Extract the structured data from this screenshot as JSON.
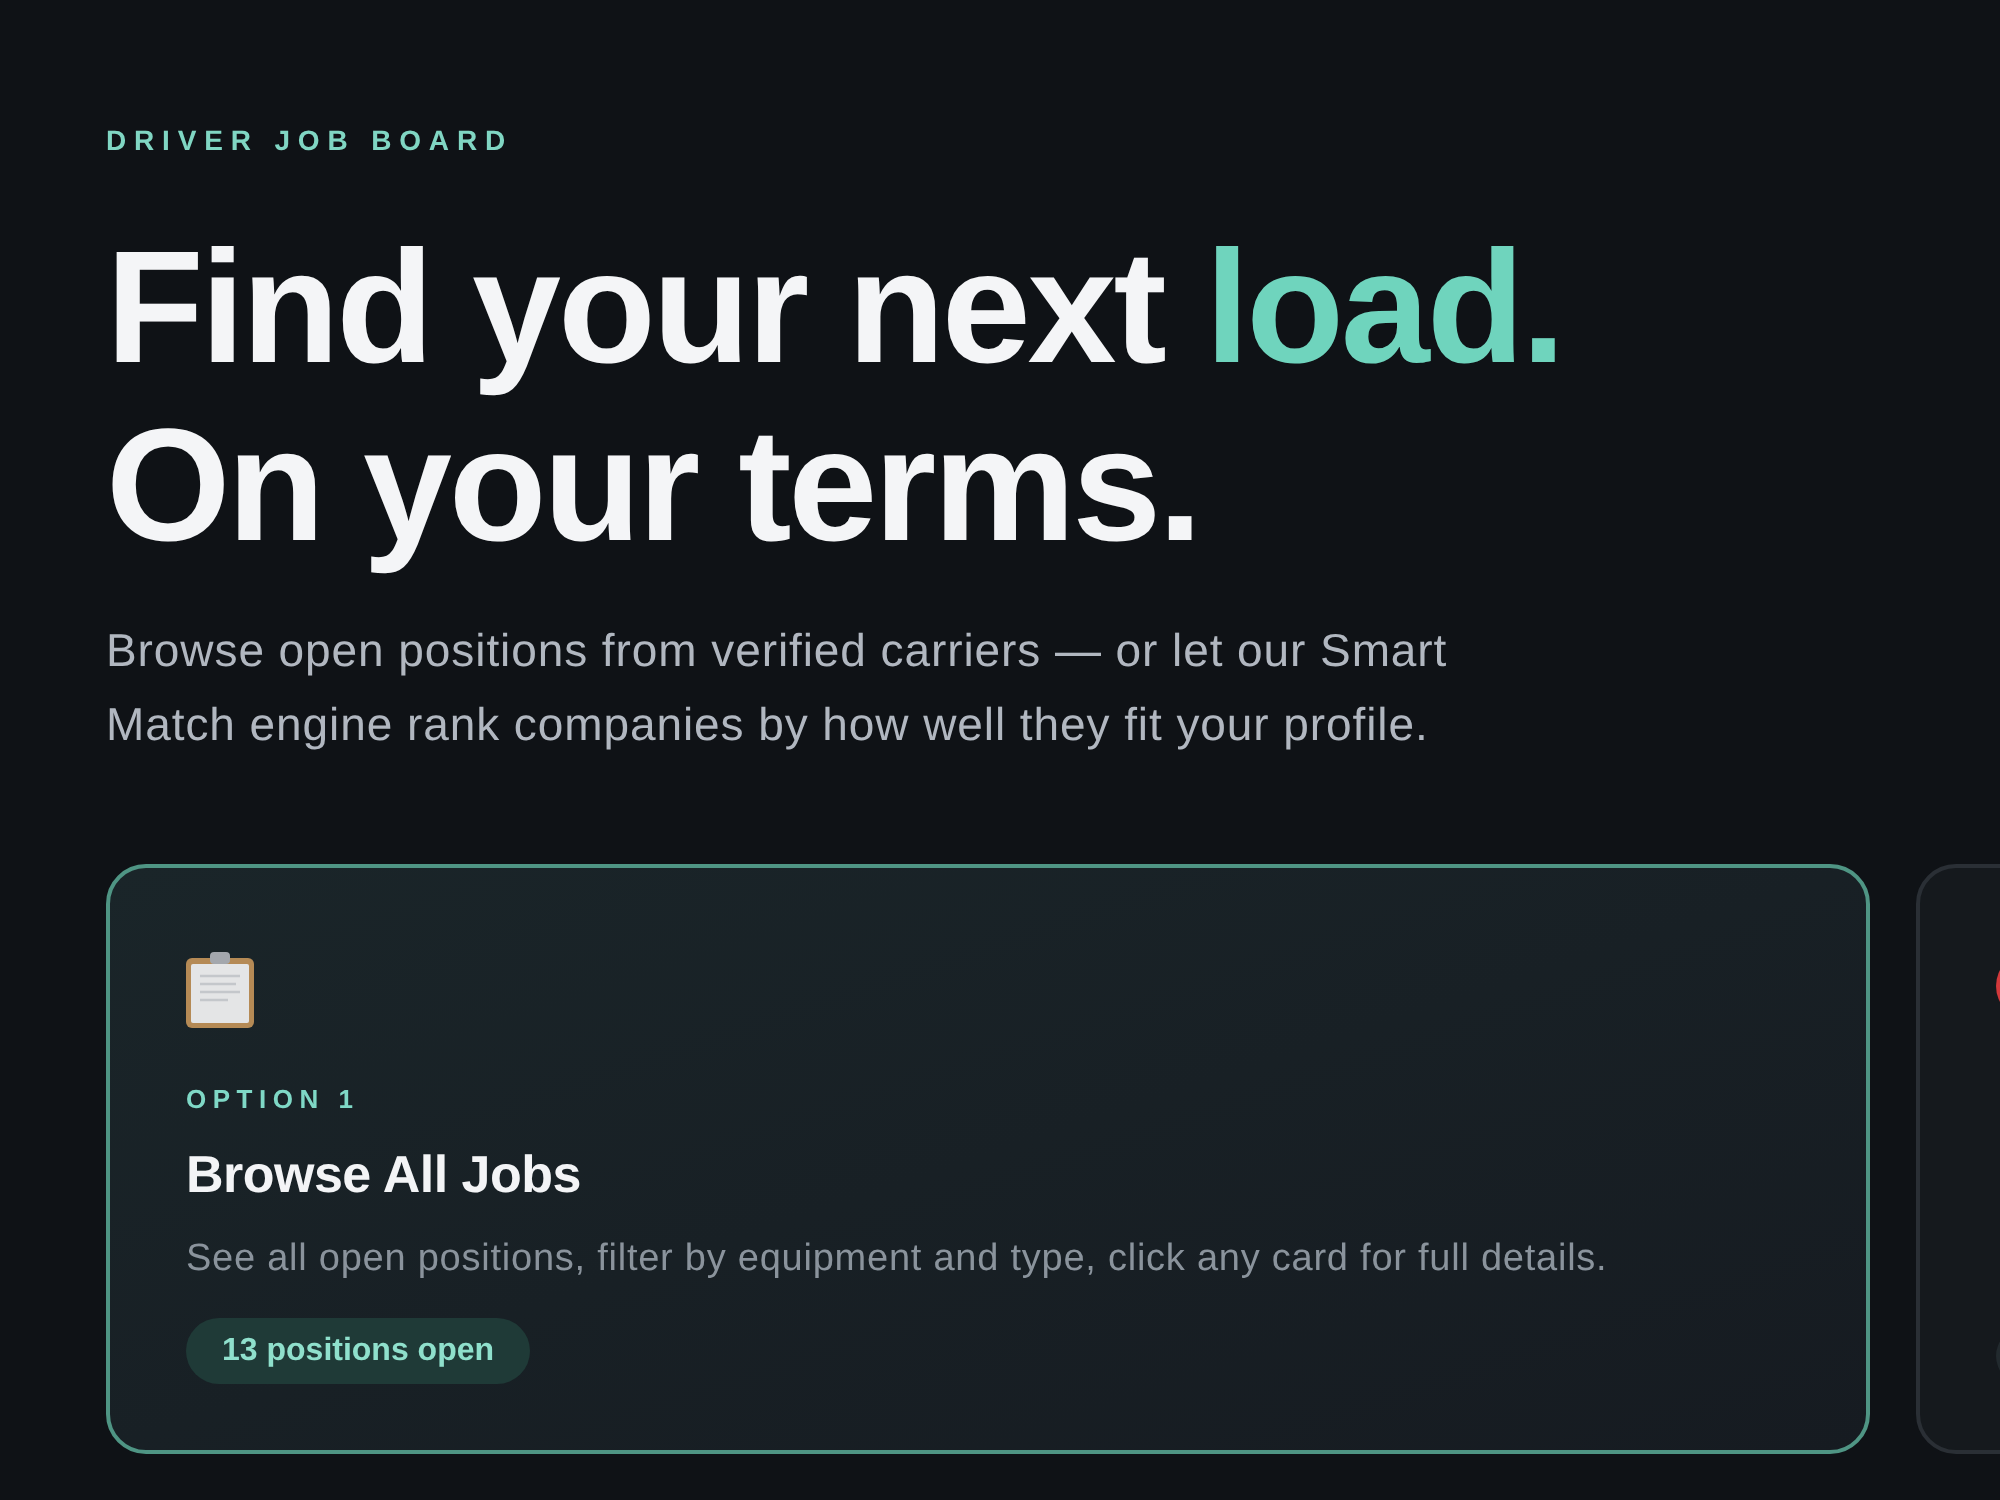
{
  "eyebrow": "DRIVER JOB BOARD",
  "headline": {
    "lines": [
      {
        "segments": [
          {
            "text": "Find your next",
            "accent": false
          },
          {
            "text": "load.",
            "accent": true
          }
        ]
      },
      {
        "segments": [
          {
            "text": "On your terms.",
            "accent": false
          }
        ]
      }
    ]
  },
  "intro": "Browse open positions from verified carriers — or let our Smart Match engine rank companies by how well they fit your profile.",
  "cards": [
    {
      "selected": true,
      "label": "OPTION 1",
      "title": "Browse All Jobs",
      "description": "See all open positions, filter by equipment and type, click any card for full details.",
      "badge": "13 positions open"
    },
    {
      "selected": false
    }
  ]
}
